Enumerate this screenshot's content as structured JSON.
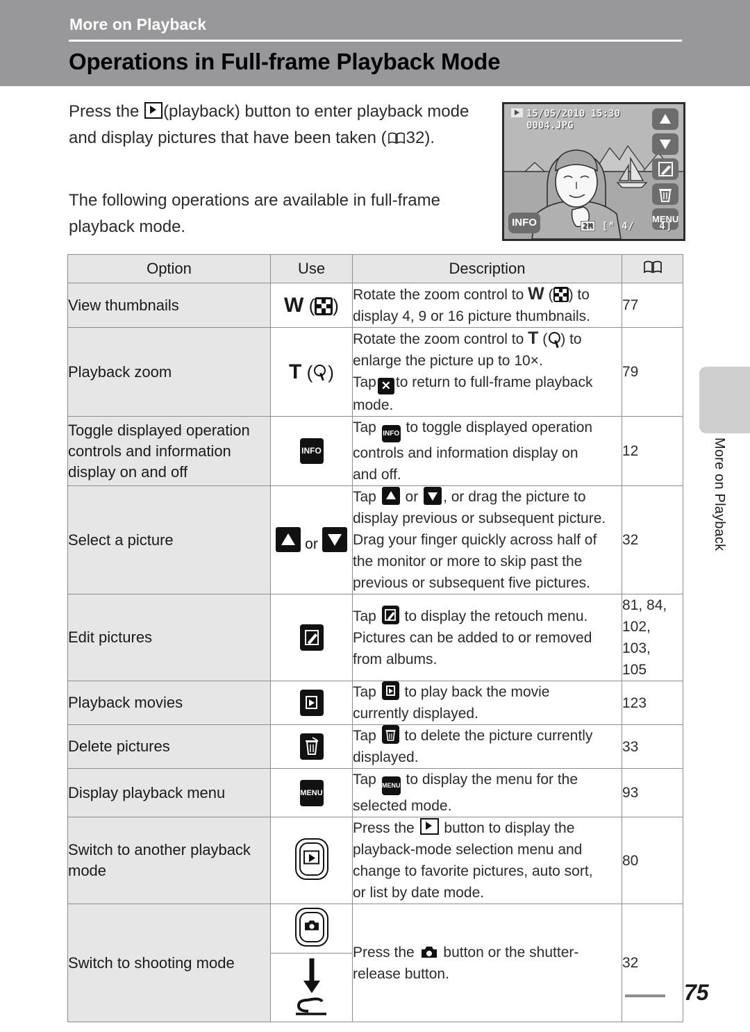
{
  "header": {
    "chapter_label": "More on Playback",
    "title": "Operations in Full-frame Playback Mode"
  },
  "intro": {
    "paragraph_1_before": "Press the",
    "paragraph_1_icon": "playback-button-icon",
    "paragraph_1_after": "(playback) button to enter playback mode and display pictures that have been taken (",
    "paragraph_1_ref_icon": "book-reference-icon",
    "paragraph_1_page": "32",
    "paragraph_1_end": ").",
    "paragraph_2": "The following operations are available in full-frame playback mode."
  },
  "camera_display": {
    "mode_icon": "playback-mode-icon",
    "date": "15/05/2010",
    "time": "15:30",
    "filename": "0004.JPG",
    "info_button": "INFO",
    "menu_button": "MENU",
    "up_button_icon": "triangle-up-icon",
    "down_button_icon": "triangle-down-icon",
    "retouch_button_icon": "retouch-pencil-icon",
    "delete_button_icon": "trash-icon",
    "image_size_chip": "2M",
    "frame_counter": "4/",
    "frame_total": "4]",
    "memory_icon": "internal-memory-icon"
  },
  "table": {
    "headers": {
      "option": "Option",
      "use": "Use",
      "description": "Description",
      "page": "book-reference-icon"
    },
    "rows": [
      {
        "option": "View thumbnails",
        "use_text": "W",
        "use_icon": "thumbnail-grid-icon",
        "desc_parts": [
          "Rotate the zoom control to ",
          "W",
          " (",
          "thumbnail-grid-icon",
          ") to display 4, 9 or 16 picture thumbnails."
        ],
        "desc_line1_a": "Rotate the zoom control to",
        "desc_line1_w": "W",
        "desc_line1_b": "to",
        "desc_line2": "display 4, 9 or 16 picture thumbnails.",
        "page": "77"
      },
      {
        "option": "Playback zoom",
        "use_text": "T",
        "use_icon": "magnifier-icon",
        "desc_line1_a": "Rotate the zoom control to",
        "desc_line1_t": "T",
        "desc_line1_b": "to",
        "desc_line2": "enlarge the picture up to 10×.",
        "desc_line3_a": "Tap",
        "desc_line3_icon": "close-x-icon",
        "desc_line3_b": "to return to full-frame playback",
        "desc_line4": "mode.",
        "page": "79"
      },
      {
        "option": "Toggle displayed operation controls and information display on and off",
        "use_icon": "info-button-icon",
        "desc_line1_a": "Tap",
        "desc_line1_icon": "info-button-icon",
        "desc_line1_b": "to toggle displayed operation",
        "desc_line2": "controls and information display on",
        "desc_line3": "and off.",
        "page": "12"
      },
      {
        "option": "Select a picture",
        "use_icon_up": "triangle-up-icon",
        "use_or": "or",
        "use_icon_down": "triangle-down-icon",
        "desc_line1_a": "Tap",
        "desc_line1_icon_up": "triangle-up-icon",
        "desc_line1_or": "or",
        "desc_line1_icon_down": "triangle-down-icon",
        "desc_line1_b": ", or drag the picture to",
        "desc_line2": "display previous or subsequent picture.",
        "desc_line3": "Drag your finger quickly across half of",
        "desc_line4": "the monitor or more to skip past the",
        "desc_line5": "previous or subsequent five pictures.",
        "page": "32"
      },
      {
        "option": "Edit pictures",
        "use_icon": "retouch-pencil-icon",
        "desc_line1_a": "Tap",
        "desc_line1_icon": "retouch-pencil-icon",
        "desc_line1_b": "to display the retouch menu.",
        "desc_line2": "Pictures can be added to or removed",
        "desc_line3": "from albums.",
        "page": "81, 84, 102, 103, 105",
        "page_lines": [
          "81, 84,",
          "102,",
          "103,",
          "105"
        ]
      },
      {
        "option": "Playback movies",
        "use_icon": "play-movie-icon",
        "desc_line1_a": "Tap",
        "desc_line1_icon": "play-movie-icon",
        "desc_line1_b": "to play back the movie",
        "desc_line2": "currently displayed.",
        "page": "123"
      },
      {
        "option": "Delete pictures",
        "use_icon": "trash-icon",
        "desc_line1_a": "Tap",
        "desc_line1_icon": "trash-icon",
        "desc_line1_b": "to delete the picture currently",
        "desc_line2": "displayed.",
        "page": "33"
      },
      {
        "option": "Display playback menu",
        "use_icon": "menu-button-icon",
        "desc_line1_a": "Tap",
        "desc_line1_icon": "menu-button-icon",
        "desc_line1_b": "to display the menu for the",
        "desc_line2": "selected mode.",
        "page": "93"
      },
      {
        "option": "Switch to another playback mode",
        "use_icon": "playback-hardware-button-icon",
        "desc_line1_a": "Press the",
        "desc_line1_icon": "playback-button-icon",
        "desc_line1_b": "button to display the",
        "desc_line2": "playback-mode selection menu and",
        "desc_line3": "change to favorite pictures, auto sort,",
        "desc_line4": "or list by date mode.",
        "page": "80"
      },
      {
        "option": "Switch to shooting mode",
        "use_icon_top": "camera-hardware-button-icon",
        "use_icon_arrow": "arrow-down-icon",
        "use_icon_bottom": "shutter-release-icon",
        "desc_line1_a": "Press the",
        "desc_line1_icon": "camera-button-icon",
        "desc_line1_b": "button or the shutter-",
        "desc_line2": "release button.",
        "page": "32"
      }
    ]
  },
  "side_tab": {
    "label": "More on Playback"
  },
  "footer": {
    "page_number": "75"
  },
  "colors": {
    "header_band": "#98989a",
    "option_cell": "#e6e6e6",
    "header_row": "#e6e6e6",
    "border": "#8d8d8d",
    "side_tab": "#cfcfcf"
  }
}
